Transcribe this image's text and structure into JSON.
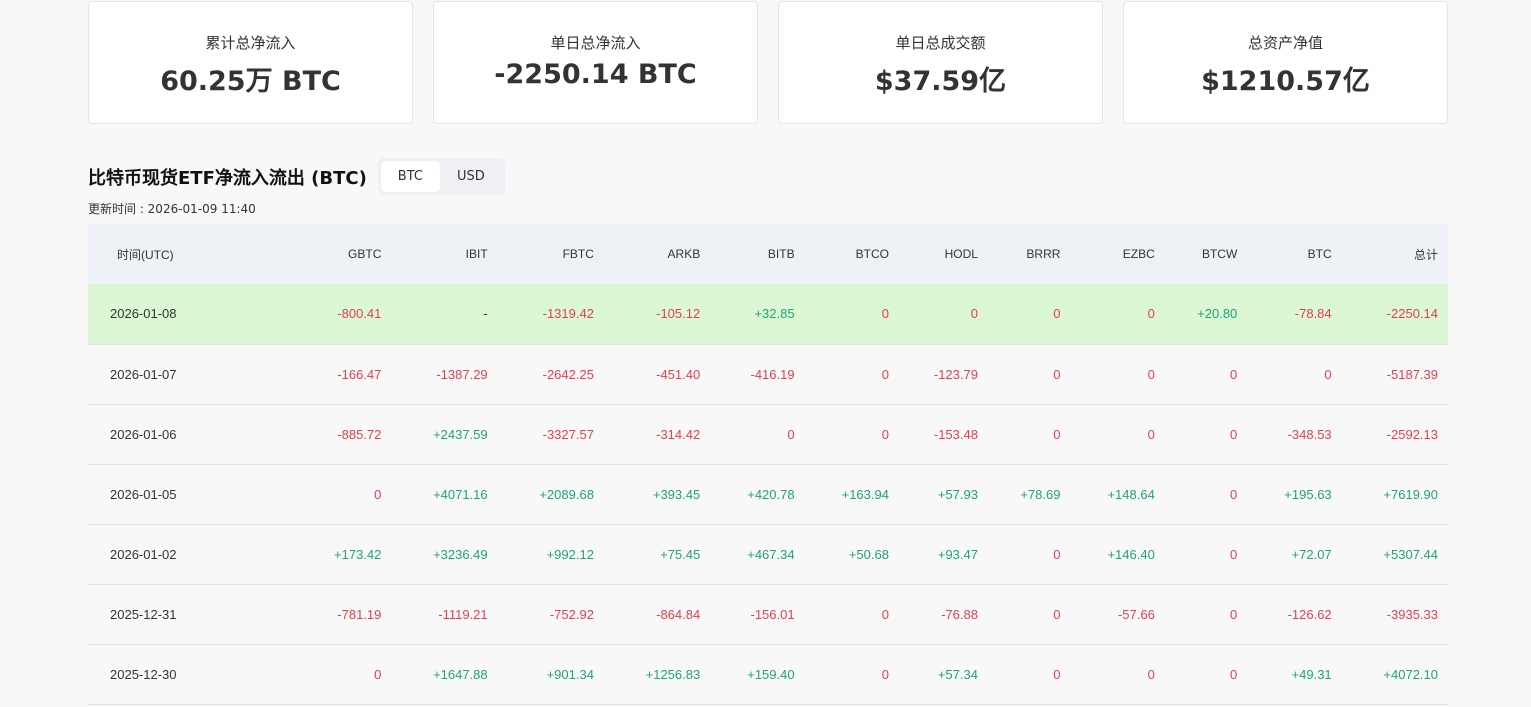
{
  "cards": [
    {
      "label": "累计总净流入",
      "value": "60.25万 BTC"
    },
    {
      "label": "单日总净流入",
      "value": "-2250.14 BTC"
    },
    {
      "label": "单日总成交额",
      "value": "$37.59亿"
    },
    {
      "label": "总资产净值",
      "value": "$1210.57亿"
    }
  ],
  "section": {
    "title": "比特币现货ETF净流入流出 (BTC)",
    "toggle": [
      "BTC",
      "USD"
    ],
    "active": "BTC",
    "updated": "更新时间 : 2026-01-09 11:40"
  },
  "colors": {
    "positive": "#1fa37a",
    "negative": "#e5404f",
    "highlight": "#dcf7d3"
  },
  "table": {
    "headers": [
      "时间(UTC)",
      "GBTC",
      "IBIT",
      "FBTC",
      "ARKB",
      "BITB",
      "BTCO",
      "HODL",
      "BRRR",
      "EZBC",
      "BTCW",
      "BTC",
      "总计"
    ],
    "rows": [
      [
        "2026-01-08",
        "-800.41",
        "-",
        "-1319.42",
        "-105.12",
        "+32.85",
        "0",
        "0",
        "0",
        "0",
        "+20.80",
        "-78.84",
        "-2250.14"
      ],
      [
        "2026-01-07",
        "-166.47",
        "-1387.29",
        "-2642.25",
        "-451.40",
        "-416.19",
        "0",
        "-123.79",
        "0",
        "0",
        "0",
        "0",
        "-5187.39"
      ],
      [
        "2026-01-06",
        "-885.72",
        "+2437.59",
        "-3327.57",
        "-314.42",
        "0",
        "0",
        "-153.48",
        "0",
        "0",
        "0",
        "-348.53",
        "-2592.13"
      ],
      [
        "2026-01-05",
        "0",
        "+4071.16",
        "+2089.68",
        "+393.45",
        "+420.78",
        "+163.94",
        "+57.93",
        "+78.69",
        "+148.64",
        "0",
        "+195.63",
        "+7619.90"
      ],
      [
        "2026-01-02",
        "+173.42",
        "+3236.49",
        "+992.12",
        "+75.45",
        "+467.34",
        "+50.68",
        "+93.47",
        "0",
        "+146.40",
        "0",
        "+72.07",
        "+5307.44"
      ],
      [
        "2025-12-31",
        "-781.19",
        "-1119.21",
        "-752.92",
        "-864.84",
        "-156.01",
        "0",
        "-76.88",
        "0",
        "-57.66",
        "0",
        "-126.62",
        "-3935.33"
      ],
      [
        "2025-12-30",
        "0",
        "+1647.88",
        "+901.34",
        "+1256.83",
        "+159.40",
        "0",
        "+57.34",
        "0",
        "0",
        "0",
        "+49.31",
        "+4072.10"
      ]
    ]
  }
}
